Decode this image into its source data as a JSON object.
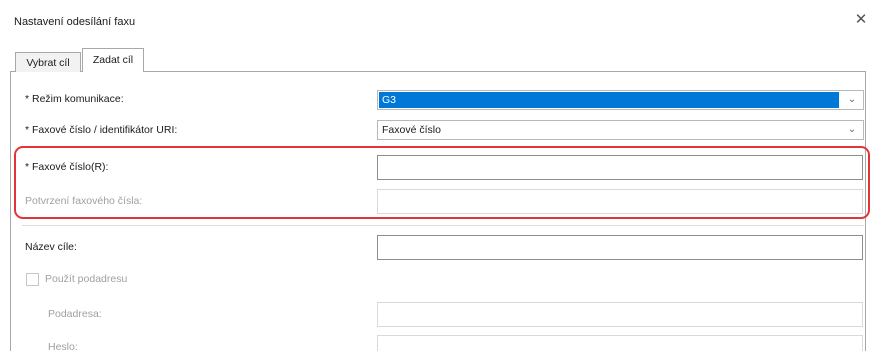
{
  "dialog": {
    "title": "Nastavení odesílání faxu",
    "close_glyph": "✕"
  },
  "tabs": [
    {
      "label": "Vybrat cíl",
      "active": false
    },
    {
      "label": "Zadat cíl",
      "active": true
    }
  ],
  "form": {
    "mode": {
      "label": "* Režim komunikace:",
      "value": "G3",
      "selected": true
    },
    "fax_type": {
      "label": "* Faxové číslo / identifikátor URI:",
      "value": "Faxové číslo"
    },
    "fax_number": {
      "label": "* Faxové číslo(R):",
      "value": ""
    },
    "fax_confirm": {
      "label": "Potvrzení faxového čísla:",
      "value": "",
      "disabled": true
    },
    "dest_name": {
      "label": "Název cíle:",
      "value": ""
    },
    "use_subaddress": {
      "label": "Použít podadresu",
      "checked": false,
      "disabled": true
    },
    "subaddress": {
      "label": "Podadresa:",
      "value": "",
      "disabled": true
    },
    "password": {
      "label": "Heslo:",
      "value": "",
      "disabled": true
    }
  },
  "icons": {
    "dropdown": "chevron-down-icon",
    "close": "close-icon"
  },
  "colors": {
    "highlight": "#e2353b",
    "selection": "#0078d7"
  }
}
